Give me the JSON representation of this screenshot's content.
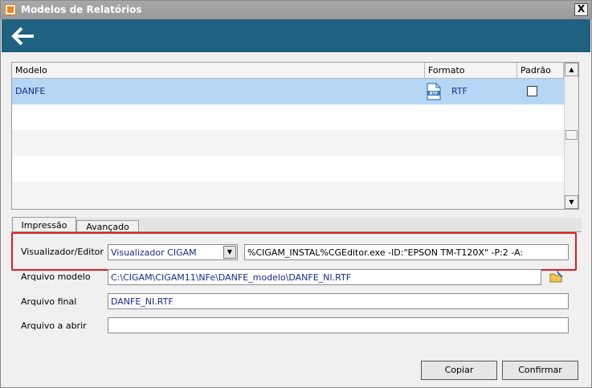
{
  "window": {
    "title": "Modelos de Relatórios",
    "close_label": "X"
  },
  "grid": {
    "columns": [
      "Modelo",
      "Formato",
      "Padrão"
    ],
    "rows": [
      {
        "modelo": "DANFE",
        "formato": "RTF",
        "padrao": false,
        "icon": "rtf-file-icon"
      }
    ]
  },
  "tabs": [
    "Impressão",
    "Avançado"
  ],
  "form": {
    "visualizador_label": "Visualizador/Editor",
    "visualizador_value": "Visualizador CIGAM",
    "visualizador_command": "%CIGAM_INSTAL%CGEditor.exe -ID:\"EPSON TM-T120X\" -P:2 -A:",
    "arquivo_modelo_label": "Arquivo modelo",
    "arquivo_modelo_value": "C:\\CIGAM\\CIGAM11\\NFe\\DANFE_modelo\\DANFE_NI.RTF",
    "arquivo_final_label": "Arquivo final",
    "arquivo_final_value": "DANFE_NI.RTF",
    "arquivo_abrir_label": "Arquivo a abrir",
    "arquivo_abrir_value": ""
  },
  "buttons": {
    "copiar": "Copiar",
    "confirmar": "Confirmar"
  },
  "colors": {
    "header": "#1e6180",
    "selection": "#b6d6f6",
    "highlight": "#e21b1b"
  }
}
